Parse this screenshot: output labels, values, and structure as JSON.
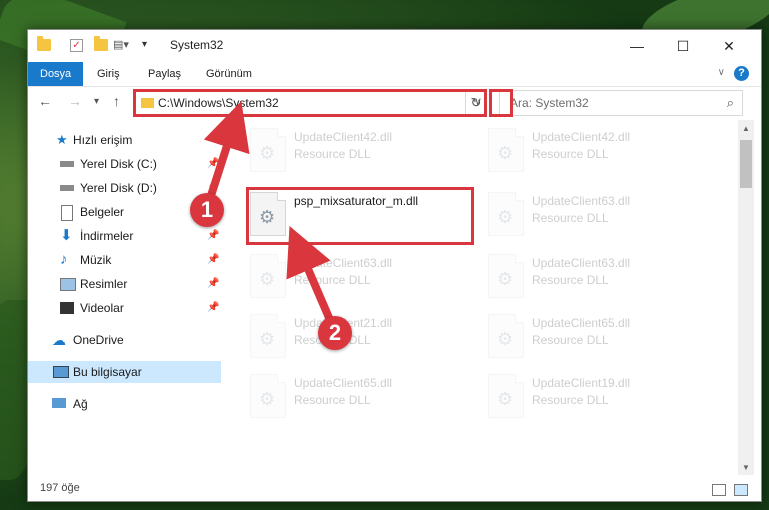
{
  "window": {
    "title": "System32",
    "controls": {
      "minimize": "—",
      "maximize": "☐",
      "close": "✕"
    }
  },
  "ribbon": {
    "tabs": [
      "Dosya",
      "Giriş",
      "Paylaş",
      "Görünüm"
    ],
    "help": "?"
  },
  "nav": {
    "address": "C:\\Windows\\System32",
    "search_placeholder": "Ara: System32"
  },
  "sidebar": {
    "items": [
      {
        "label": "Hızlı erişim",
        "icon": "star-icon",
        "pinned": false
      },
      {
        "label": "Yerel Disk (C:)",
        "icon": "drive-icon",
        "pinned": true
      },
      {
        "label": "Yerel Disk (D:)",
        "icon": "drive-icon",
        "pinned": true
      },
      {
        "label": "Belgeler",
        "icon": "documents-icon",
        "pinned": true
      },
      {
        "label": "İndirmeler",
        "icon": "download-icon",
        "pinned": true
      },
      {
        "label": "Müzik",
        "icon": "music-icon",
        "pinned": true
      },
      {
        "label": "Resimler",
        "icon": "pictures-icon",
        "pinned": true
      },
      {
        "label": "Videolar",
        "icon": "video-icon",
        "pinned": true
      },
      {
        "label": "OneDrive",
        "icon": "cloud-icon",
        "pinned": false
      },
      {
        "label": "Bu bilgisayar",
        "icon": "computer-icon",
        "pinned": false,
        "selected": true
      },
      {
        "label": "Ağ",
        "icon": "network-icon",
        "pinned": false
      }
    ]
  },
  "files": {
    "col1": [
      {
        "name": "UpdateClient42.dll",
        "type": "Resource DLL"
      },
      {
        "name": "psp_mixsaturator_m.dll",
        "type": ""
      },
      {
        "name": "UpdateClient63.dll",
        "type": "Resource DLL"
      },
      {
        "name": "UpdateClient21.dll",
        "type": "Resource DLL"
      },
      {
        "name": "UpdateClient65.dll",
        "type": "Resource DLL"
      }
    ],
    "col2": [
      {
        "name": "UpdateClient42.dll",
        "type": "Resource DLL"
      },
      {
        "name": "UpdateClient63.dll",
        "type": "Resource DLL"
      },
      {
        "name": "UpdateClient63.dll",
        "type": "Resource DLL"
      },
      {
        "name": "UpdateClient65.dll",
        "type": "Resource DLL"
      },
      {
        "name": "UpdateClient19.dll",
        "type": "Resource DLL"
      }
    ]
  },
  "status": {
    "count": "197 öğe"
  },
  "annotations": {
    "badge1": "1",
    "badge2": "2",
    "color": "#d9363e"
  }
}
